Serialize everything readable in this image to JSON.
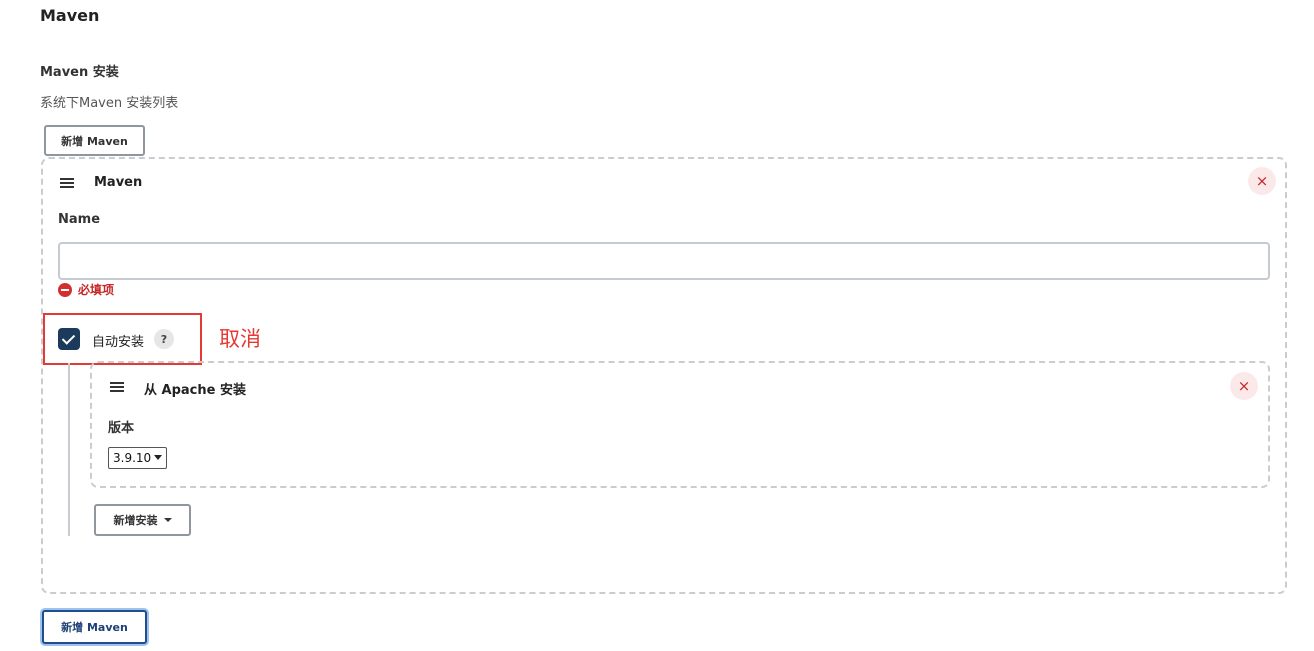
{
  "section": {
    "title": "Maven"
  },
  "installations": {
    "label": "Maven 安装",
    "description": "系统下Maven 安装列表",
    "add_button_label": "新增 Maven",
    "item": {
      "title": "Maven",
      "delete_icon": "×",
      "name_label": "Name",
      "name_value": "",
      "name_error": "必填项",
      "auto_install_label": "自动安装",
      "auto_install_checked": true,
      "help_icon": "?",
      "annotation": "取消",
      "installer": {
        "title": "从 Apache 安装",
        "delete_icon": "×",
        "version_label": "版本",
        "version_selected": "3.9.10"
      },
      "add_installer_label": "新增安装"
    }
  },
  "colors": {
    "error": "#c62828",
    "annotation": "#e53935",
    "checkbox": "#1b3a5c",
    "focus": "#1f4d8f"
  }
}
